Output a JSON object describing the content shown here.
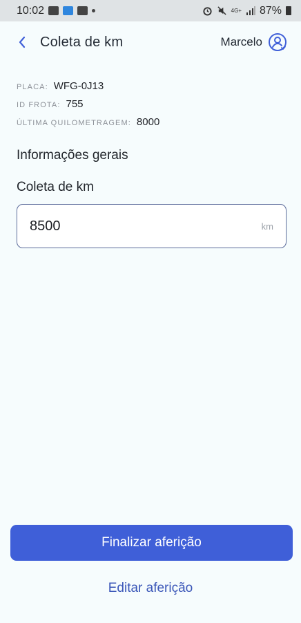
{
  "status_bar": {
    "time": "10:02",
    "network": "4G+",
    "battery": "87%"
  },
  "header": {
    "title": "Coleta de km",
    "user_name": "Marcelo",
    "back_icon": "chevron-left-icon",
    "avatar_icon": "user-circle-icon"
  },
  "vehicle_info": {
    "plate_label": "PLACA:",
    "plate_value": "WFG-0J13",
    "fleet_label": "ID FROTA:",
    "fleet_value": "755",
    "last_km_label": "ÚLTIMA QUILOMETRAGEM:",
    "last_km_value": "8000"
  },
  "section": {
    "title": "Informações gerais",
    "field_label": "Coleta de km"
  },
  "km_input": {
    "value": "8500",
    "unit": "km"
  },
  "actions": {
    "finish_label": "Finalizar aferição",
    "edit_label": "Editar aferição"
  },
  "colors": {
    "accent": "#3f5fd8",
    "link": "#3a56b8",
    "background": "#f6fcfd"
  }
}
